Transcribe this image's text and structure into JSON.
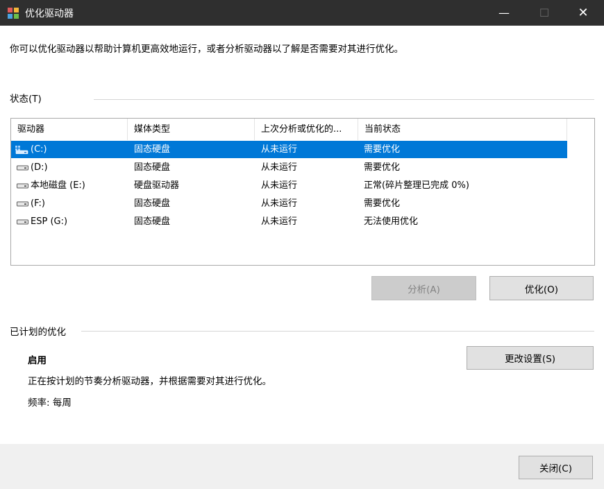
{
  "window": {
    "title": "优化驱动器",
    "controls": {
      "minimize": "—",
      "maximize": "☐",
      "close": "✕"
    }
  },
  "intro": "你可以优化驱动器以帮助计算机更高效地运行，或者分析驱动器以了解是否需要对其进行优化。",
  "status_section": {
    "label": "状态(T)",
    "columns": [
      "驱动器",
      "媒体类型",
      "上次分析或优化的...",
      "当前状态"
    ],
    "rows": [
      {
        "drive": "(C:)",
        "media": "固态硬盘",
        "last": "从未运行",
        "status": "需要优化",
        "selected": true,
        "icon": "system-drive-icon"
      },
      {
        "drive": "(D:)",
        "media": "固态硬盘",
        "last": "从未运行",
        "status": "需要优化",
        "selected": false,
        "icon": "drive-icon"
      },
      {
        "drive": "本地磁盘 (E:)",
        "media": "硬盘驱动器",
        "last": "从未运行",
        "status": "正常(碎片整理已完成 0%)",
        "selected": false,
        "icon": "drive-icon"
      },
      {
        "drive": "(F:)",
        "media": "固态硬盘",
        "last": "从未运行",
        "status": "需要优化",
        "selected": false,
        "icon": "drive-icon"
      },
      {
        "drive": "ESP (G:)",
        "media": "固态硬盘",
        "last": "从未运行",
        "status": "无法使用优化",
        "selected": false,
        "icon": "drive-icon"
      }
    ],
    "analyze_button": "分析(A)",
    "optimize_button": "优化(O)"
  },
  "scheduled_section": {
    "label": "已计划的优化",
    "state": "启用",
    "description": "正在按计划的节奏分析驱动器，并根据需要对其进行优化。",
    "frequency": "频率: 每周",
    "change_settings_button": "更改设置(S)"
  },
  "footer": {
    "close_button": "关闭(C)"
  },
  "colors": {
    "selection": "#0078d7",
    "titlebar": "#2f2f2f"
  }
}
